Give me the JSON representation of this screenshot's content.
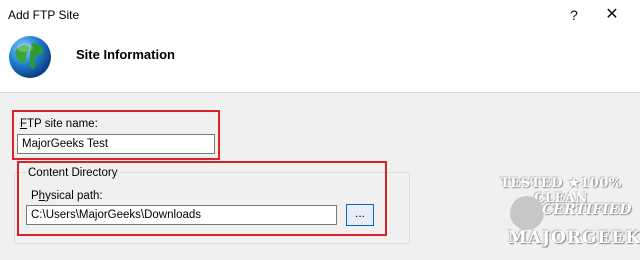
{
  "window": {
    "title": "Add FTP Site",
    "help_glyph": "?",
    "close_glyph": "✕"
  },
  "header": {
    "title": "Site Information",
    "icon": "globe-icon"
  },
  "ftp_site_name": {
    "label_access_key": "F",
    "label_rest": "TP site name:",
    "value": "MajorGeeks Test"
  },
  "content_directory": {
    "group_label": "Content Directory",
    "physical_path": {
      "label_pre": "P",
      "label_access_key": "h",
      "label_rest": "ysical path:",
      "value": "C:\\Users\\MajorGeeks\\Downloads",
      "browse_label": "..."
    }
  },
  "watermark": {
    "top": "TESTED ★100% CLEAN",
    "middle": "CERTIFIED",
    "bottom": "MAJORGEEKS"
  },
  "colors": {
    "highlight": "#d9232a",
    "browse_border": "#0a64c8"
  }
}
